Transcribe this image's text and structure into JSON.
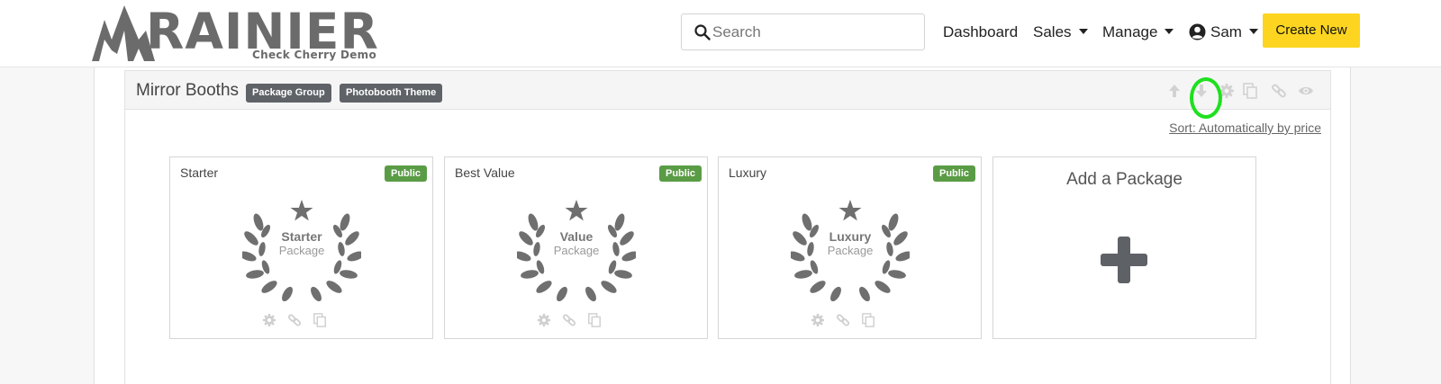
{
  "brand": {
    "name": "RAINIER",
    "tagline": "Check Cherry Demo",
    "color": "#6b6b6b"
  },
  "search": {
    "placeholder": "Search",
    "value": ""
  },
  "nav": {
    "dashboard": "Dashboard",
    "sales": "Sales",
    "manage": "Manage",
    "user": "Sam",
    "create_new": "Create New"
  },
  "panel": {
    "title": "Mirror Booths",
    "badges": [
      "Package Group",
      "Photobooth Theme"
    ],
    "header_icons": [
      "arrow-up-icon",
      "arrow-down-icon",
      "gear-icon",
      "copy-icon",
      "link-icon",
      "eye-icon"
    ],
    "sort_link": "Sort: Automatically by price"
  },
  "packages": [
    {
      "name": "Starter",
      "status": "Public",
      "wreath_line1": "Starter",
      "wreath_line2": "Package"
    },
    {
      "name": "Best Value",
      "status": "Public",
      "wreath_line1": "Value",
      "wreath_line2": "Package"
    },
    {
      "name": "Luxury",
      "status": "Public",
      "wreath_line1": "Luxury",
      "wreath_line2": "Package"
    }
  ],
  "add_package": {
    "label": "Add a Package"
  },
  "colors": {
    "accent": "#fdd520",
    "public_badge": "#5a9c45",
    "dark_badge": "#5f6368",
    "highlight": "#1fe01f"
  }
}
